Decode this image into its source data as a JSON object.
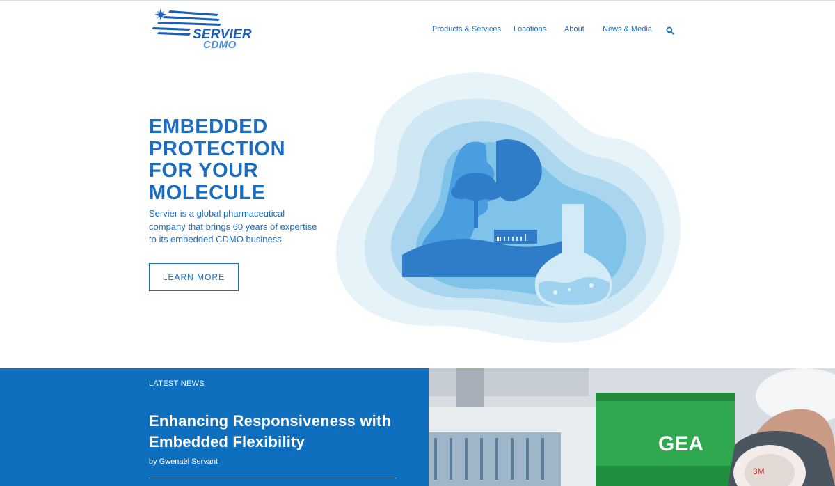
{
  "header": {
    "logo": {
      "line1": "SERVIER",
      "line2": "CDMO"
    },
    "nav": [
      "Products & Services",
      "Locations",
      "About",
      "News & Media"
    ],
    "search_icon": "search-icon"
  },
  "hero": {
    "title_lines": [
      "EMBEDDED",
      "PROTECTION",
      "FOR YOUR",
      "MOLECULE"
    ],
    "description": "Servier is a global pharmaceutical company that brings 60 years of expertise to its embedded CDMO business.",
    "button_label": "LEARN MORE",
    "illustration": "paper-cut-face-flask-illustration"
  },
  "news": {
    "kicker": "LATEST NEWS",
    "title": "Enhancing Responsiveness with Embedded Flexibility",
    "author": "by Gwenaël Servant",
    "photo": "lab-technician-photo",
    "photo_brand": "GEA",
    "photo_mask_label": "3M"
  },
  "colors": {
    "brand_blue": "#1a6dc0",
    "news_panel": "#0f6fbf",
    "illus_light": "#e3f1f8",
    "illus_mid": "#7fc3e8",
    "illus_dark": "#2f7cc9"
  }
}
